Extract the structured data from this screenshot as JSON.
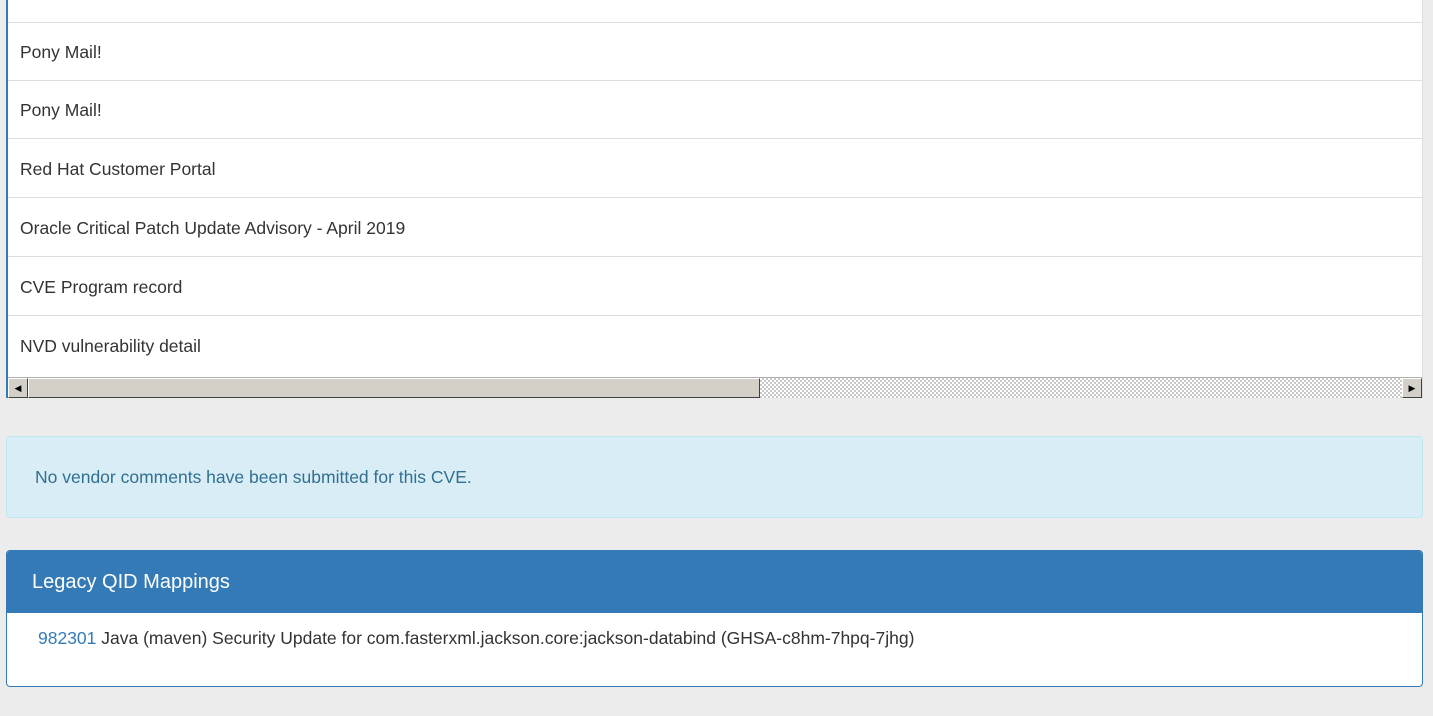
{
  "references": {
    "items": [
      "Pony Mail!",
      "Pony Mail!",
      "Red Hat Customer Portal",
      "Oracle Critical Patch Update Advisory - April 2019",
      "CVE Program record",
      "NVD vulnerability detail"
    ]
  },
  "vendor_comments": {
    "message": "No vendor comments have been submitted for this CVE."
  },
  "legacy_qid": {
    "title": "Legacy QID Mappings",
    "qid": "982301",
    "description": "Java (maven) Security Update for com.fasterxml.jackson.core:jackson-databind (GHSA-c8hm-7hpq-7jhg)"
  },
  "icons": {
    "scroll_left": "arrow-left-icon",
    "scroll_right": "arrow-right-icon"
  },
  "colors": {
    "accent": "#337ab7",
    "info_bg": "#d9edf7",
    "info_text": "#31708f"
  }
}
